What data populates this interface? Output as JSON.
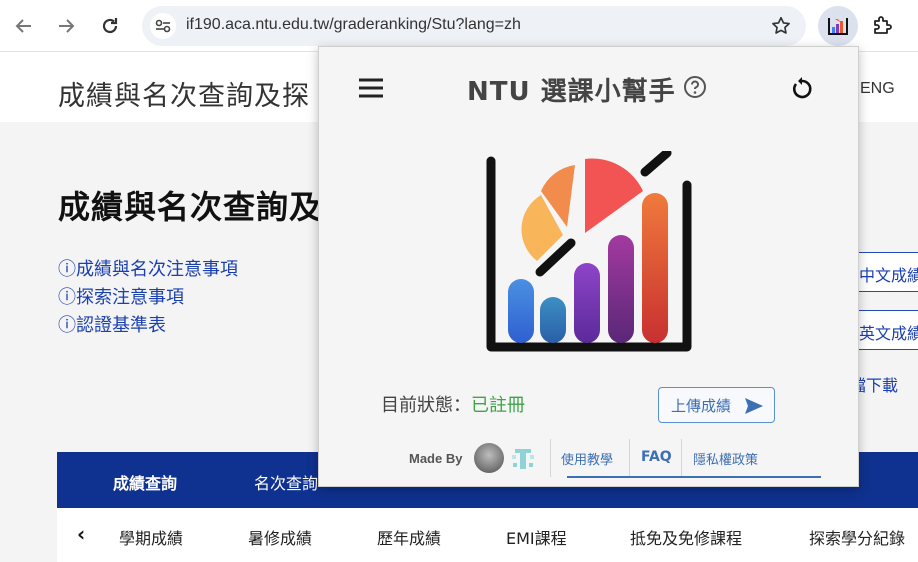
{
  "browser": {
    "url": "if190.aca.ntu.edu.tw/graderanking/Stu?lang=zh"
  },
  "site": {
    "header_title": "成績與名次查詢及探",
    "lang_switch": "ENG",
    "page_title": "成績與名次查詢及",
    "info_links": [
      "成績與名次注意事項",
      "探索注意事項",
      "認證基準表"
    ],
    "info_icon": "ⓘ",
    "side_buttons": [
      "中文成績",
      "英文成績"
    ],
    "side_download": "檔下載",
    "tabs": [
      "成績查詢",
      "名次查詢"
    ],
    "subtabs": [
      "學期成績",
      "暑修成績",
      "歷年成績",
      "EMI課程",
      "抵免及免修課程",
      "探索學分紀錄"
    ],
    "subtab_back": "‹"
  },
  "popup": {
    "title": "NTU 選課小幫手",
    "status_label": "目前狀態：",
    "status_value": "已註冊",
    "upload_label": "上傳成績",
    "made_by": "Made By",
    "links": [
      "使用教學",
      "FAQ",
      "隱私權政策"
    ]
  },
  "colors": {
    "brand_blue": "#0f318f",
    "link_blue": "#1a3fb0",
    "status_green": "#3fa34a"
  }
}
